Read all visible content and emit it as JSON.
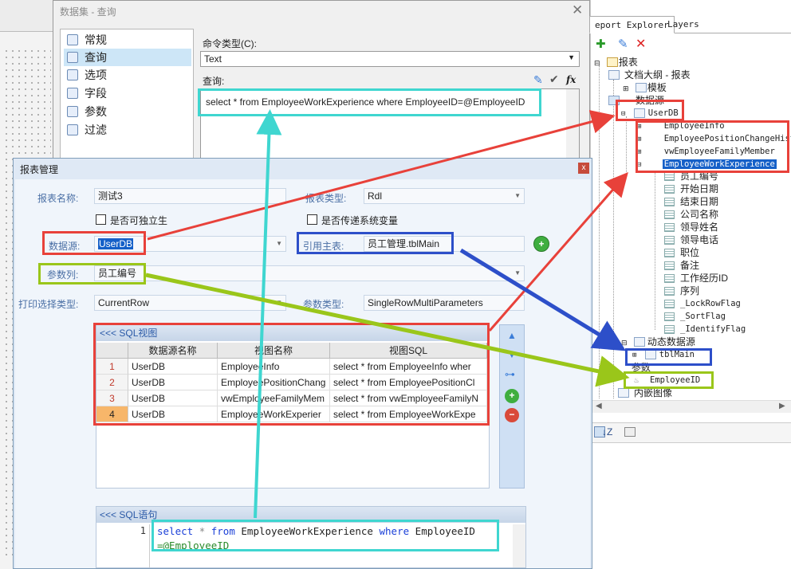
{
  "dataset_dialog": {
    "title": "数据集 - 查询",
    "close": "✕",
    "nav": [
      "常规",
      "查询",
      "选项",
      "字段",
      "参数",
      "过滤"
    ],
    "command_type_label": "命令类型(C):",
    "command_type_value": "Text",
    "query_label": "查询:",
    "query_text": "select * from EmployeeWorkExperience where EmployeeID=@EmployeeID",
    "fx": "fx"
  },
  "explorer": {
    "tabs": [
      "eport Explorer",
      "Layers"
    ],
    "tree": {
      "root": "报表",
      "outline": "文档大纲 - 报表",
      "template": "模板",
      "datasource": "数据源",
      "userdb": "UserDB",
      "datasets": [
        "EmployeeInfo",
        "EmployeePositionChangeHist",
        "vwEmployeeFamilyMember",
        "EmployeeWorkExperience"
      ],
      "fields": [
        "员工编号",
        "开始日期",
        "结束日期",
        "公司名称",
        "领导姓名",
        "领导电话",
        "职位",
        "备注",
        "工作经历ID",
        "序列",
        "_LockRowFlag",
        "_SortFlag",
        "_IdentifyFlag"
      ],
      "dynamic_ds": "动态数据源",
      "tbl_main": "tblMain",
      "params": "参数",
      "param_item": "EmployeeID",
      "embedded_images": "内嵌图像"
    }
  },
  "report_dialog": {
    "title": "报表管理",
    "close": "x",
    "report_name_label": "报表名称:",
    "report_name_value": "测试3",
    "report_type_label": "报表类型:",
    "report_type_value": "Rdl",
    "standalone_label": "是否可独立生",
    "pass_sysvar_label": "是否传递系统变量",
    "datasource_label": "数据源:",
    "datasource_value": "UserDB",
    "ref_table_label": "引用主表:",
    "ref_table_value": "员工管理.tblMain",
    "param_col_label": "参数列:",
    "param_col_value": "员工编号",
    "print_type_label": "打印选择类型:",
    "print_type_value": "CurrentRow",
    "param_type_label": "参数类型:",
    "param_type_value": "SingleRowMultiParameters",
    "sql_view_header": "<<< SQL视图",
    "columns": [
      "数据源名称",
      "视图名称",
      "视图SQL"
    ],
    "rows": [
      {
        "n": "1",
        "ds": "UserDB",
        "view": "EmployeeInfo",
        "sql": "select * from EmployeeInfo wher"
      },
      {
        "n": "2",
        "ds": "UserDB",
        "view": "EmployeePositionChang",
        "sql": "select * from EmployeePositionCl"
      },
      {
        "n": "3",
        "ds": "UserDB",
        "view": "vwEmployeeFamilyMem",
        "sql": "select * from vwEmployeeFamilyN"
      },
      {
        "n": "4",
        "ds": "UserDB",
        "view": "EmployeeWorkExperier",
        "sql": "select * from EmployeeWorkExpe"
      }
    ],
    "sql_stmt_header": "<<< SQL语句",
    "line_no": "1",
    "sql_kw_select": "select",
    "sql_star": "*",
    "sql_kw_from": "from",
    "sql_table": "EmployeeWorkExperience",
    "sql_kw_where": "where",
    "sql_col": "EmployeeID",
    "sql_line2": "=@EmployeeID"
  },
  "colors": {
    "red": "#e8413a",
    "cyan": "#3fd6d0",
    "lime": "#9ac61a",
    "blue": "#2d4fc9"
  }
}
